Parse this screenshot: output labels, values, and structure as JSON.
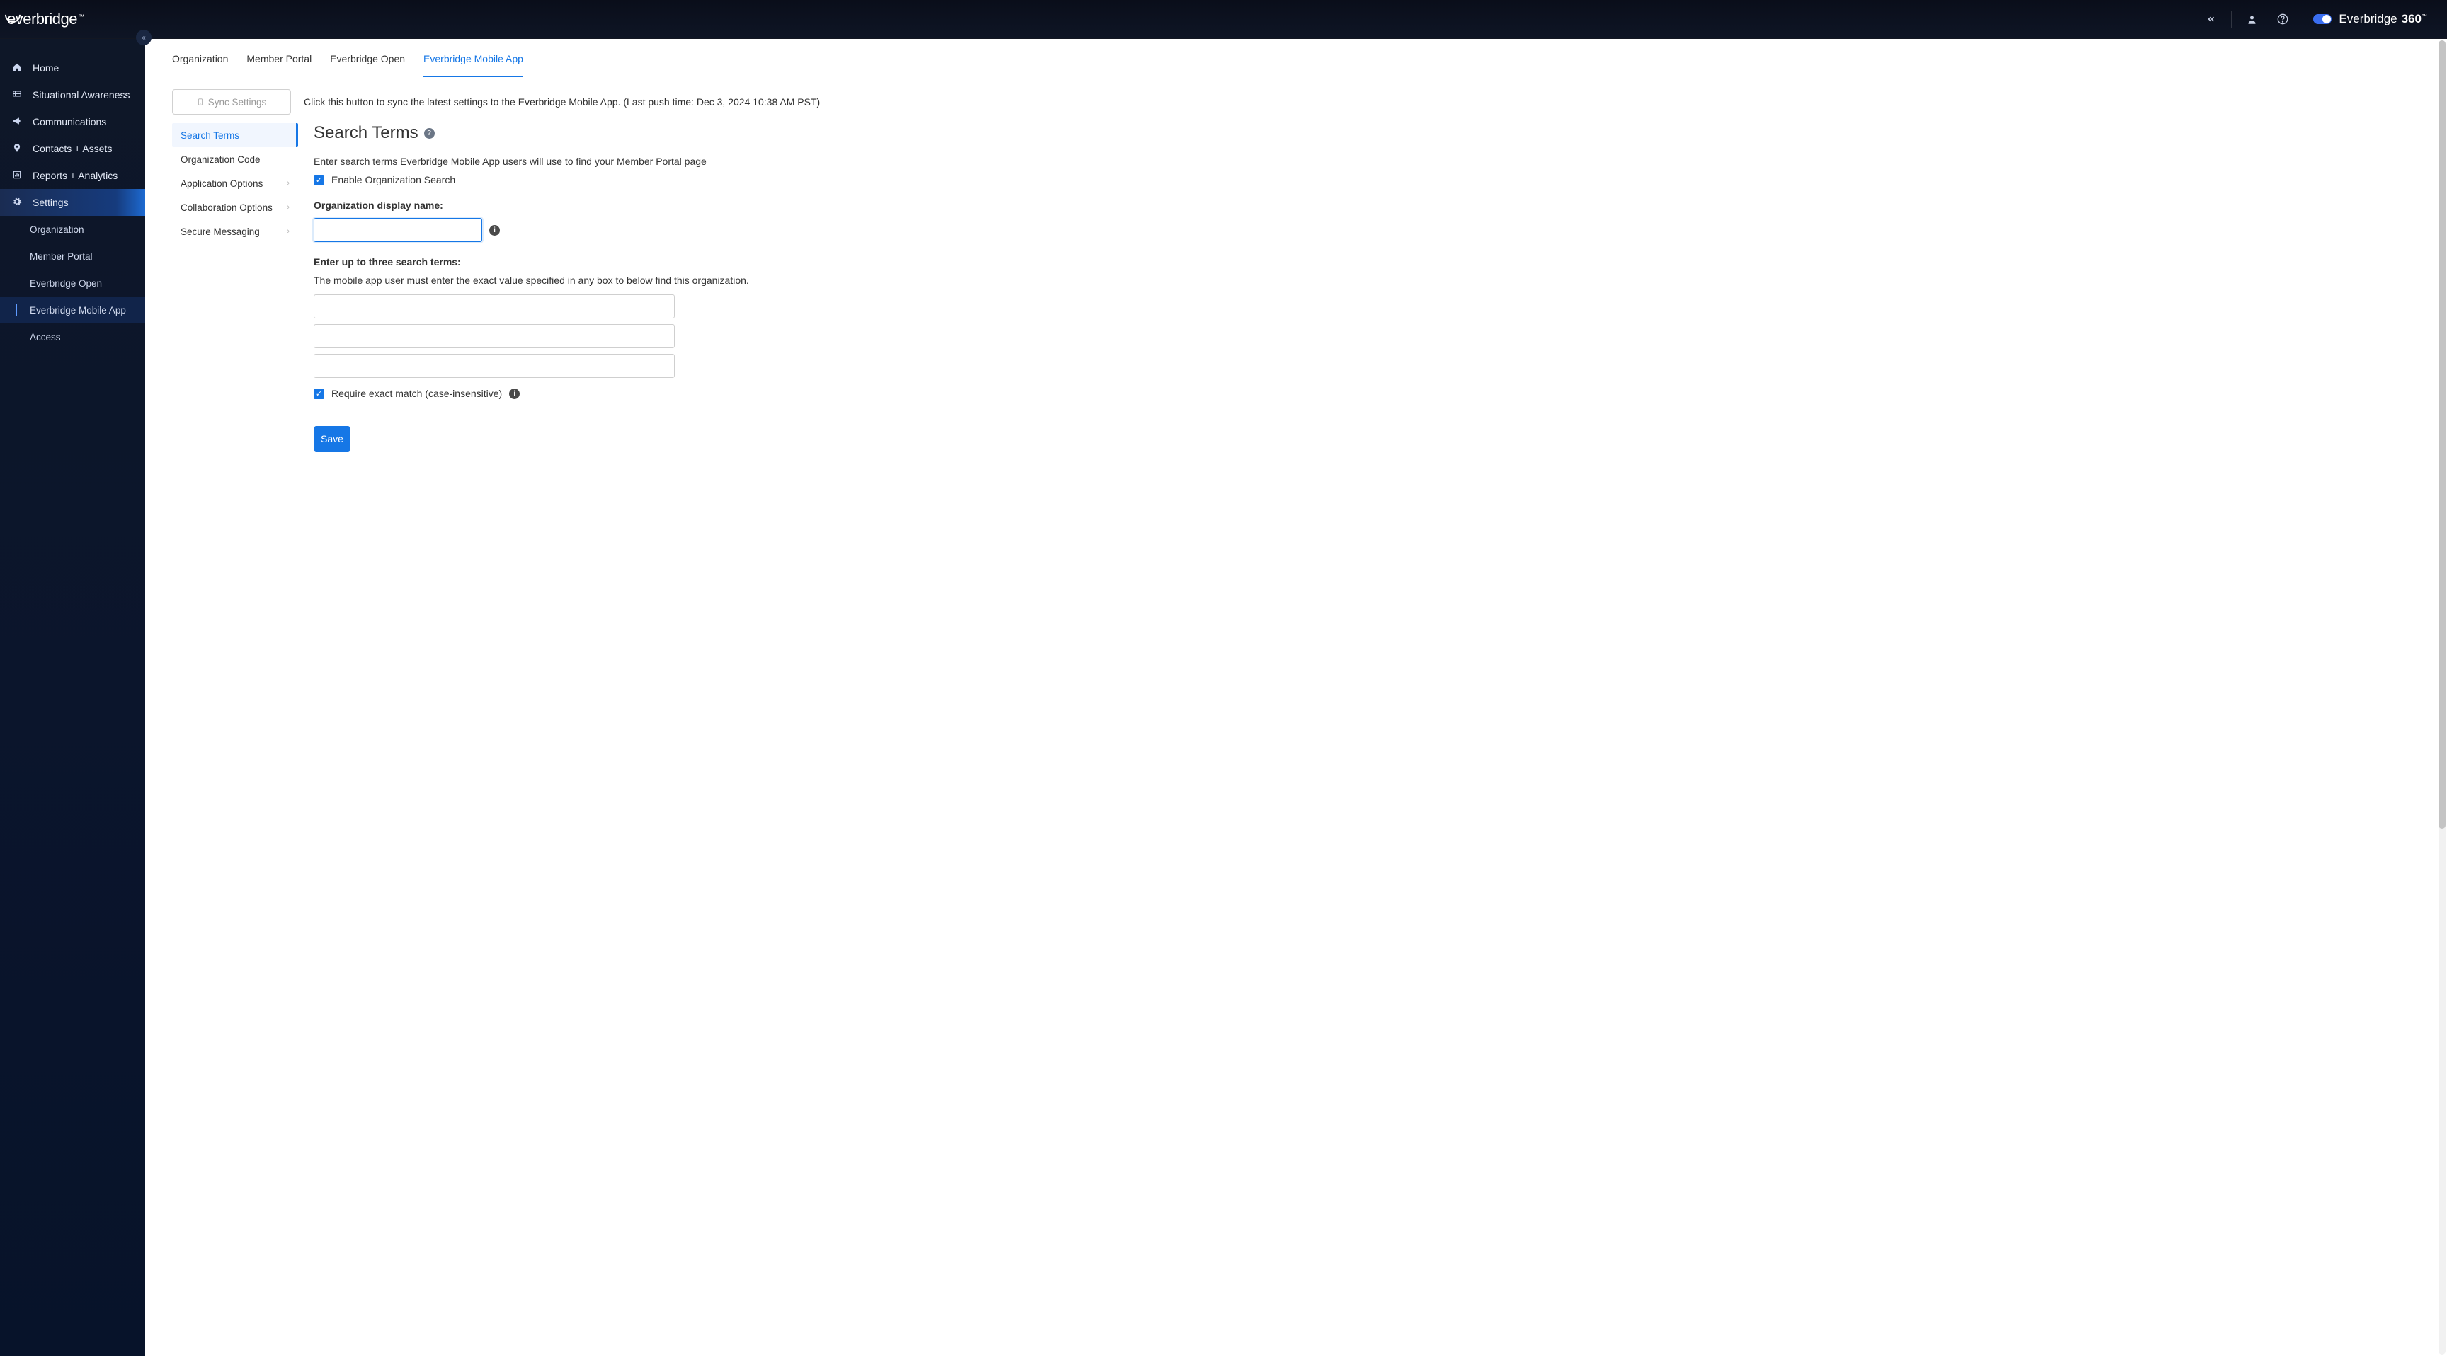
{
  "header": {
    "logo_text": "everbridge",
    "logo_tm": "™",
    "collapse_chevron": "«",
    "toggle_on": true,
    "brand_right_main": "Everbridge",
    "brand_right_accent": "360",
    "brand_right_tm": "™"
  },
  "sidebar": {
    "items": [
      {
        "icon": "home-icon",
        "glyph": "⌂",
        "label": "Home"
      },
      {
        "icon": "sitaware-icon",
        "glyph": "◧",
        "label": "Situational Awareness"
      },
      {
        "icon": "comms-icon",
        "glyph": "📢",
        "label": "Communications"
      },
      {
        "icon": "contacts-icon",
        "glyph": "◎",
        "label": "Contacts + Assets"
      },
      {
        "icon": "reports-icon",
        "glyph": "▥",
        "label": "Reports + Analytics"
      },
      {
        "icon": "settings-icon",
        "glyph": "⚙",
        "label": "Settings",
        "active": true
      }
    ],
    "sub_items": [
      {
        "label": "Organization"
      },
      {
        "label": "Member Portal"
      },
      {
        "label": "Everbridge Open"
      },
      {
        "label": "Everbridge Mobile App",
        "active": true
      },
      {
        "label": "Access"
      }
    ]
  },
  "tabs": [
    {
      "label": "Organization"
    },
    {
      "label": "Member Portal"
    },
    {
      "label": "Everbridge Open"
    },
    {
      "label": "Everbridge Mobile App",
      "active": true
    }
  ],
  "sync": {
    "button_label": "Sync Settings",
    "message": "Click this button to sync the latest settings to the Everbridge Mobile App. (Last push time: Dec 3, 2024 10:38 AM PST)"
  },
  "settings_submenu": [
    {
      "label": "Search Terms",
      "active": true
    },
    {
      "label": "Organization Code"
    },
    {
      "label": "Application Options",
      "expandable": true
    },
    {
      "label": "Collaboration Options",
      "expandable": true
    },
    {
      "label": "Secure Messaging",
      "expandable": true
    }
  ],
  "form": {
    "title": "Search Terms",
    "description": "Enter search terms Everbridge Mobile App users will use to find your Member Portal page",
    "enable_label": "Enable Organization Search",
    "enable_checked": true,
    "display_name_label": "Organization display name:",
    "display_name_value": "",
    "search_terms_label": "Enter up to three search terms:",
    "search_terms_desc": "The mobile app user must enter the exact value specified in any box to below find this organization.",
    "terms": [
      "",
      "",
      ""
    ],
    "exact_match_label": "Require exact match (case-insensitive)",
    "exact_match_checked": true,
    "save_label": "Save"
  }
}
